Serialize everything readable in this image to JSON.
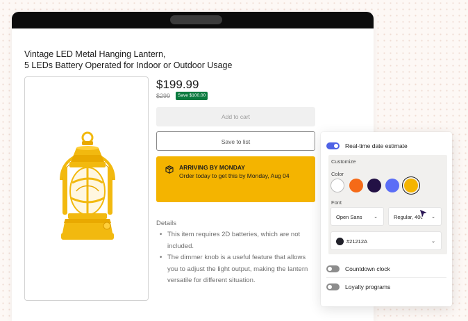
{
  "product": {
    "title_line1": "Vintage LED Metal Hanging Lantern,",
    "title_line2": "5 LEDs Battery Operated for Indoor or Outdoor Usage",
    "price": "$199.99",
    "old_price": "$299",
    "save_badge": "Save $100.00",
    "add_to_cart_label": "Add to cart",
    "save_to_list_label": "Save to list",
    "image_icon": "lantern-image"
  },
  "delivery": {
    "icon": "package-icon",
    "heading": "ARRIVING BY MONDAY",
    "message": "Order today to get this by Monday, Aug 04"
  },
  "details": {
    "title": "Details",
    "items": [
      "This item requires 2D batteries, which are not included.",
      "The dimmer knob is a useful feature that allows you to adjust the light output, making the lantern versatile for different situation."
    ]
  },
  "panel": {
    "realtime_toggle": {
      "label": "Real-time date estimate",
      "on": true
    },
    "customize_label": "Customize",
    "color_label": "Color",
    "swatches": [
      {
        "name": "white",
        "hex": "#ffffff"
      },
      {
        "name": "orange",
        "hex": "#f56a17"
      },
      {
        "name": "dark-purple",
        "hex": "#231145"
      },
      {
        "name": "blue",
        "hex": "#5b6ef6"
      },
      {
        "name": "yellow",
        "hex": "#f4b400",
        "selected": true
      }
    ],
    "font_label": "Font",
    "font_family": "Open Sans",
    "font_weight": "Regular, 400",
    "text_color": "#21212A",
    "countdown_toggle": {
      "label": "Countdown clock",
      "on": false
    },
    "loyalty_toggle": {
      "label": "Loyalty programs",
      "on": false
    }
  },
  "colors": {
    "accent": "#4f63e6",
    "delivery_banner": "#f4b400",
    "save_badge": "#0a7a3e",
    "titlebar": "#0c0c0c"
  }
}
